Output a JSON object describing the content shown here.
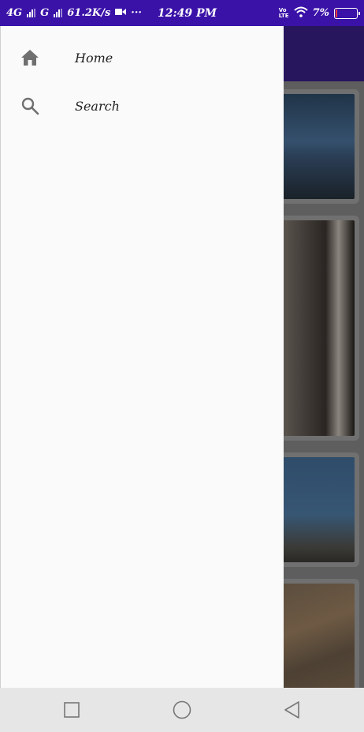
{
  "status_bar": {
    "network_1": "4G",
    "network_2": "G",
    "speed": "61.2K/s",
    "more": "···",
    "time": "12:49 PM",
    "volte": "Vo\nLTE",
    "battery_text": "7%",
    "battery_level": 0.07,
    "background_color": "#3a12a8"
  },
  "drawer": {
    "items": [
      {
        "label": "Home",
        "icon": "home-icon"
      },
      {
        "label": "Search",
        "icon": "search-icon"
      }
    ]
  },
  "nav_bar": {
    "recent_icon": "square-icon",
    "home_icon": "circle-icon",
    "back_icon": "triangle-back-icon"
  },
  "colors": {
    "drawer_background": "#fafafa",
    "scrim": "#5e5e5e",
    "toolbar": "#27155e",
    "icon_gray": "#6f6f6f"
  }
}
